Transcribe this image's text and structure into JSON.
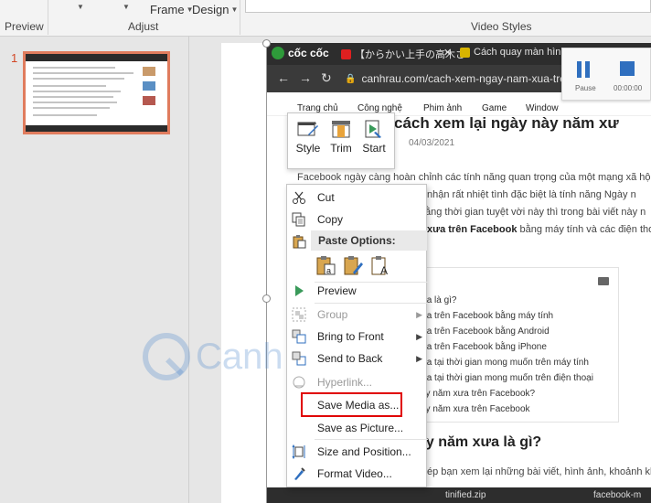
{
  "ribbon": {
    "preview_label": "Preview",
    "adjust_label": "Adjust",
    "video_styles_label": "Video Styles",
    "frame_label": "Frame",
    "design_label": "Design"
  },
  "thumbnails": {
    "slide_number": "1"
  },
  "browser": {
    "logo_text": "cốc cốc",
    "tabs": [
      "【からかい上手の高木さ",
      "Cách quay màn hìn"
    ],
    "url": "canhrau.com/cach-xem-ngay-nam-xua-tren-",
    "nav": [
      "Trang chủ",
      "Công nghệ",
      "Phim ảnh",
      "Game",
      "Window"
    ],
    "title": "cách xem lại ngày này năm xư",
    "date": "04/03/2021",
    "para1": "Facebook ngày càng hoàn chỉnh các tính năng quan trọng của một mạng xã hội",
    "para2": "nhận rất nhiệt tình đặc biệt là tính năng Ngày n",
    "para3": "ằng thời gian tuyệt vời này thì trong bài viết này n",
    "para4_bold": "xưa trên Facebook",
    "para4_rest": " bằng máy tính và các điện thoại",
    "toc_items": [
      "ưa là gì?",
      "ưa trên Facebook bằng máy tính",
      "ưa trên Facebook bằng Android",
      "ưa trên Facebook bằng iPhone",
      "ưa tại thời gian mong muốn trên máy tính",
      "ưa tại thời gian mong muốn trên điện thoại",
      "ày năm xưa trên Facebook?",
      "ày năm xưa trên Facebook"
    ],
    "heading2": "ày năm xưa là gì?",
    "para5": "ép bạn xem lại những bài viết, hình ảnh, khoảnh kh",
    "downloads": [
      "tinified.zip",
      "facebook-m"
    ]
  },
  "player": {
    "pause_label": "Pause",
    "time": "00:00:00"
  },
  "mini_toolbar": {
    "style_label": "Style",
    "trim_label": "Trim",
    "start_label": "Start"
  },
  "context_menu": {
    "cut": "Cut",
    "copy": "Copy",
    "paste_options": "Paste Options:",
    "preview": "Preview",
    "group": "Group",
    "bring_to_front": "Bring to Front",
    "send_to_back": "Send to Back",
    "hyperlink": "Hyperlink...",
    "save_media_as": "Save Media as...",
    "save_as_picture": "Save as Picture...",
    "size_and_position": "Size and Position...",
    "format_video": "Format Video..."
  },
  "watermark": {
    "text": "Canh Rau"
  },
  "colors": {
    "accent_blue": "#2f6fbf",
    "highlight_red": "#e00000",
    "thumb_border": "#e07c5e"
  }
}
